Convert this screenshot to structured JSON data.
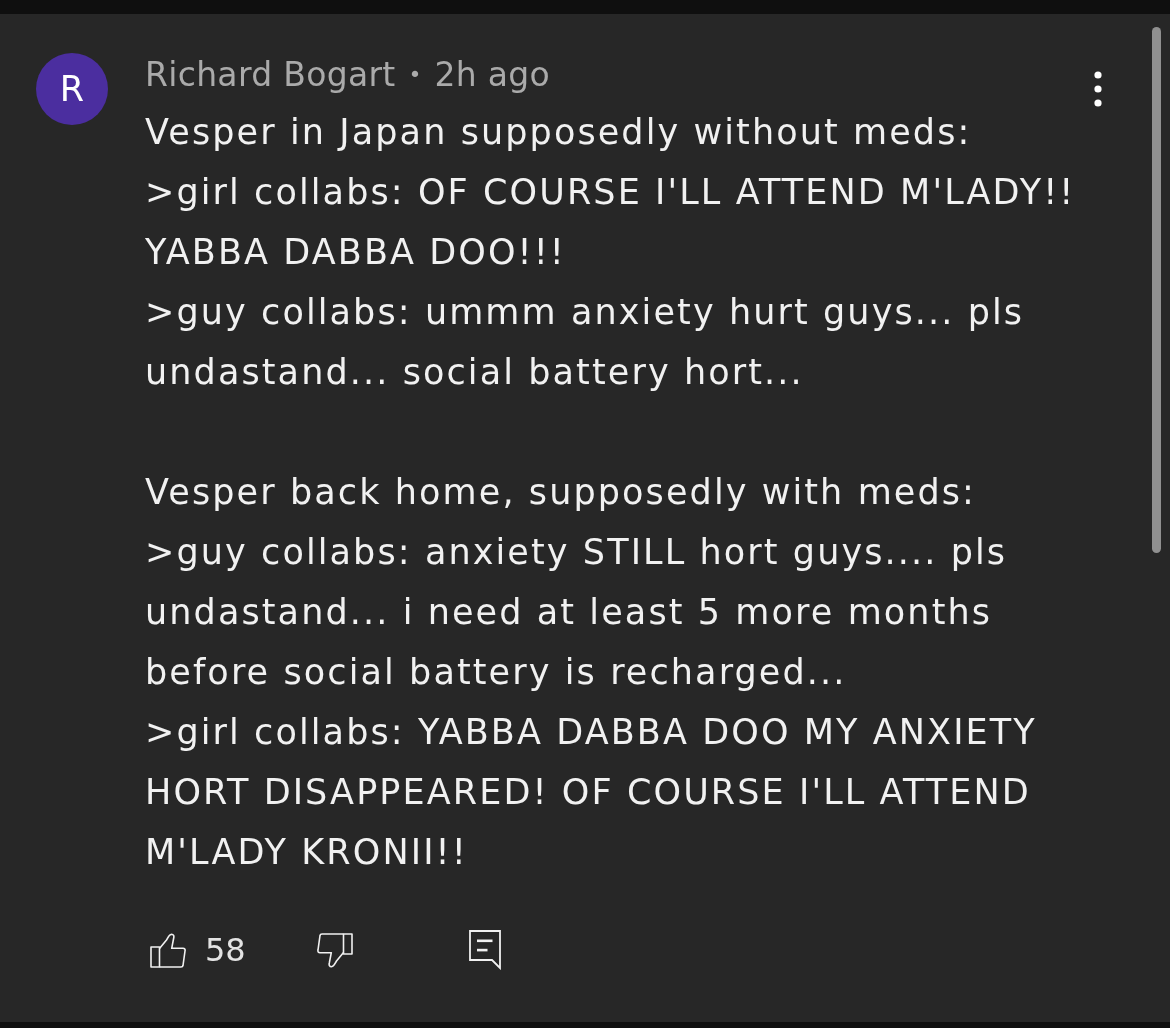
{
  "comment": {
    "avatar_letter": "R",
    "author": "Richard Bogart",
    "separator": "•",
    "time": "2h ago",
    "text": "Vesper in Japan supposedly without meds:\n>girl collabs: OF COURSE I'LL ATTEND M'LADY!!\nYABBA DABBA DOO!!!\n>guy collabs: ummm anxiety hurt guys... pls\nundastand... social battery hort...\n\nVesper back home, supposedly with meds:\n>guy collabs: anxiety STILL hort guys.... pls\nundastand... i need at least 5 more months\nbefore social battery is recharged...\n>girl collabs: YABBA DABBA DOO MY ANXIETY\nHORT DISAPPEARED! OF COURSE I'LL ATTEND\nM'LADY KRONII!!",
    "likes": "58"
  }
}
